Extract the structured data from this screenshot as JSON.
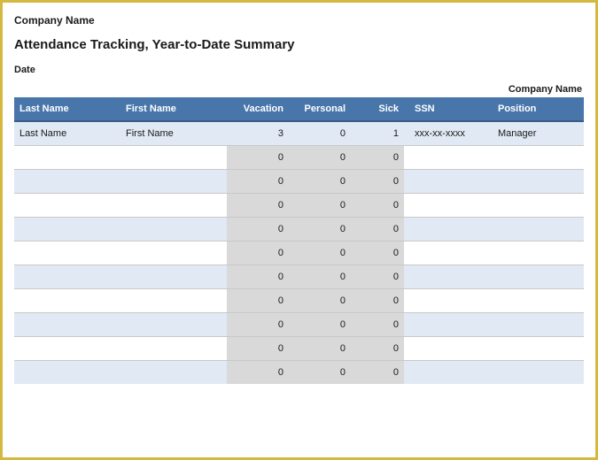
{
  "header": {
    "company_name": "Company Name",
    "title": "Attendance Tracking, Year-to-Date Summary",
    "date_label": "Date",
    "right_label": "Company Name"
  },
  "columns": {
    "last_name": "Last Name",
    "first_name": "First Name",
    "vacation": "Vacation",
    "personal": "Personal",
    "sick": "Sick",
    "ssn": "SSN",
    "position": "Position"
  },
  "rows": [
    {
      "last_name": "Last Name",
      "first_name": "First Name",
      "vacation": 3,
      "personal": 0,
      "sick": 1,
      "ssn": "xxx-xx-xxxx",
      "position": "Manager"
    },
    {
      "last_name": "",
      "first_name": "",
      "vacation": 0,
      "personal": 0,
      "sick": 0,
      "ssn": "",
      "position": ""
    },
    {
      "last_name": "",
      "first_name": "",
      "vacation": 0,
      "personal": 0,
      "sick": 0,
      "ssn": "",
      "position": ""
    },
    {
      "last_name": "",
      "first_name": "",
      "vacation": 0,
      "personal": 0,
      "sick": 0,
      "ssn": "",
      "position": ""
    },
    {
      "last_name": "",
      "first_name": "",
      "vacation": 0,
      "personal": 0,
      "sick": 0,
      "ssn": "",
      "position": ""
    },
    {
      "last_name": "",
      "first_name": "",
      "vacation": 0,
      "personal": 0,
      "sick": 0,
      "ssn": "",
      "position": ""
    },
    {
      "last_name": "",
      "first_name": "",
      "vacation": 0,
      "personal": 0,
      "sick": 0,
      "ssn": "",
      "position": ""
    },
    {
      "last_name": "",
      "first_name": "",
      "vacation": 0,
      "personal": 0,
      "sick": 0,
      "ssn": "",
      "position": ""
    },
    {
      "last_name": "",
      "first_name": "",
      "vacation": 0,
      "personal": 0,
      "sick": 0,
      "ssn": "",
      "position": ""
    },
    {
      "last_name": "",
      "first_name": "",
      "vacation": 0,
      "personal": 0,
      "sick": 0,
      "ssn": "",
      "position": ""
    },
    {
      "last_name": "",
      "first_name": "",
      "vacation": 0,
      "personal": 0,
      "sick": 0,
      "ssn": "",
      "position": ""
    }
  ],
  "chart_data": {
    "type": "table",
    "title": "Attendance Tracking, Year-to-Date Summary",
    "columns": [
      "Last Name",
      "First Name",
      "Vacation",
      "Personal",
      "Sick",
      "SSN",
      "Position"
    ],
    "rows": [
      [
        "Last Name",
        "First Name",
        3,
        0,
        1,
        "xxx-xx-xxxx",
        "Manager"
      ],
      [
        "",
        "",
        0,
        0,
        0,
        "",
        ""
      ],
      [
        "",
        "",
        0,
        0,
        0,
        "",
        ""
      ],
      [
        "",
        "",
        0,
        0,
        0,
        "",
        ""
      ],
      [
        "",
        "",
        0,
        0,
        0,
        "",
        ""
      ],
      [
        "",
        "",
        0,
        0,
        0,
        "",
        ""
      ],
      [
        "",
        "",
        0,
        0,
        0,
        "",
        ""
      ],
      [
        "",
        "",
        0,
        0,
        0,
        "",
        ""
      ],
      [
        "",
        "",
        0,
        0,
        0,
        "",
        ""
      ],
      [
        "",
        "",
        0,
        0,
        0,
        "",
        ""
      ],
      [
        "",
        "",
        0,
        0,
        0,
        "",
        ""
      ]
    ]
  },
  "colors": {
    "border": "#d4b840",
    "header_bg": "#4876ab",
    "row_alt": "#e1e9f4",
    "num_bg": "#d9d9d9"
  }
}
